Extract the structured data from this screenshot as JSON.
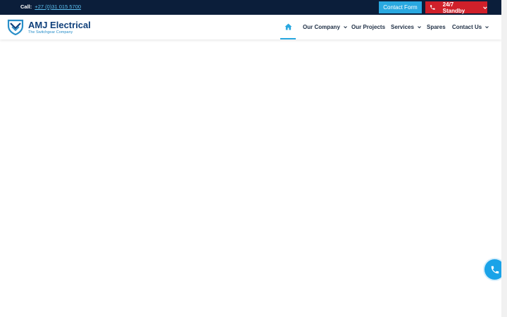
{
  "topbar": {
    "call_label": "Call:",
    "phone_number": "+27 (0)31 015 5700",
    "contact_form_label": "Contact Form",
    "standby_label": "24/7 Standby"
  },
  "logo": {
    "title": "AMJ Electrical",
    "subtitle": "The Switchgear Company"
  },
  "nav": {
    "items": [
      {
        "label": "Our Company"
      },
      {
        "label": "Our Projects"
      },
      {
        "label": "Services"
      },
      {
        "label": "Spares"
      },
      {
        "label": "Contact Us"
      }
    ]
  },
  "colors": {
    "topbar_bg": "#0b1e3a",
    "accent_blue": "#29a8e0",
    "standby_red": "#d0202a",
    "brand_navy": "#0f3f7a"
  },
  "icons": {
    "home": "home-icon",
    "phone": "phone-icon",
    "chevron": "chevron-down-icon",
    "call_fab": "phone-icon"
  }
}
